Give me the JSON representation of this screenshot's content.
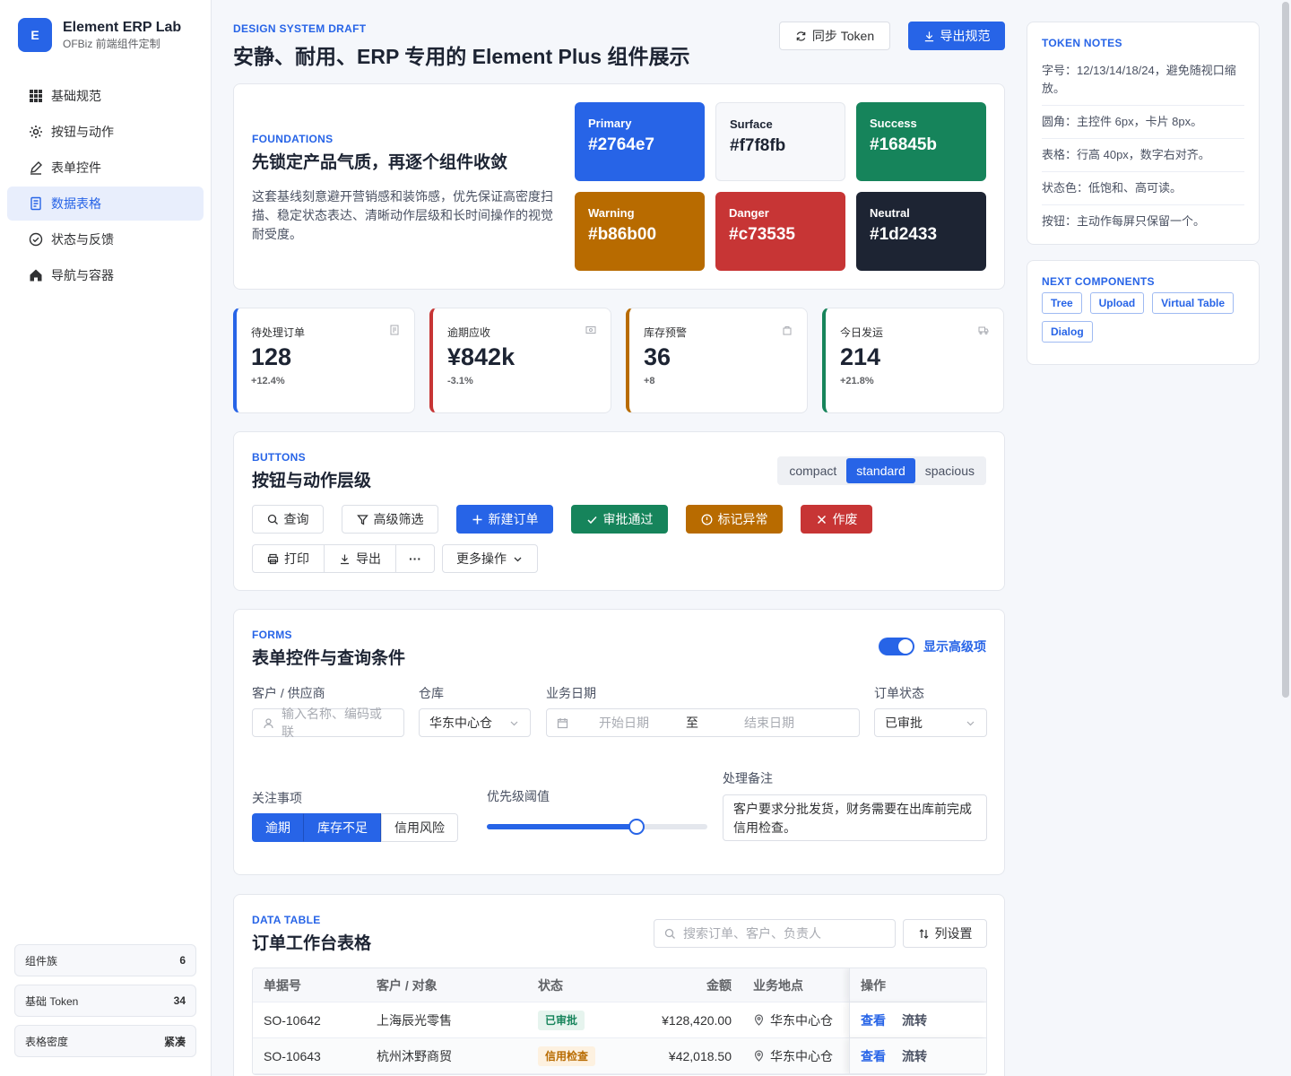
{
  "brand": {
    "logo": "E",
    "title": "Element ERP Lab",
    "subtitle": "OFBiz 前端组件定制"
  },
  "nav": [
    {
      "label": "基础规范",
      "icon": "grid-icon"
    },
    {
      "label": "按钮与动作",
      "icon": "gear-icon"
    },
    {
      "label": "表单控件",
      "icon": "edit-icon"
    },
    {
      "label": "数据表格",
      "icon": "document-icon",
      "active": true
    },
    {
      "label": "状态与反馈",
      "icon": "check-circle-icon"
    },
    {
      "label": "导航与容器",
      "icon": "home-icon"
    }
  ],
  "side_stats": [
    {
      "label": "组件族",
      "value": "6"
    },
    {
      "label": "基础 Token",
      "value": "34"
    },
    {
      "label": "表格密度",
      "value": "紧凑"
    }
  ],
  "header": {
    "eyebrow": "DESIGN SYSTEM DRAFT",
    "title": "安静、耐用、ERP 专用的 Element Plus 组件展示",
    "sync_label": "同步 Token",
    "export_label": "导出规范"
  },
  "foundations": {
    "eyebrow": "FOUNDATIONS",
    "title": "先锁定产品气质，再逐个组件收敛",
    "desc": "这套基线刻意避开营销感和装饰感，优先保证高密度扫描、稳定状态表达、清晰动作层级和长时间操作的视觉耐受度。",
    "swatches": [
      {
        "name": "Primary",
        "hex": "#2764e7",
        "bg": "#2764e7",
        "fg": "#ffffff"
      },
      {
        "name": "Surface",
        "hex": "#f7f8fb",
        "bg": "#f7f8fb",
        "fg": "#1d2433"
      },
      {
        "name": "Success",
        "hex": "#16845b",
        "bg": "#16845b",
        "fg": "#ffffff"
      },
      {
        "name": "Warning",
        "hex": "#b86b00",
        "bg": "#b86b00",
        "fg": "#ffffff"
      },
      {
        "name": "Danger",
        "hex": "#c73535",
        "bg": "#c73535",
        "fg": "#ffffff"
      },
      {
        "name": "Neutral",
        "hex": "#1d2433",
        "bg": "#1d2433",
        "fg": "#ffffff"
      }
    ]
  },
  "kpis": [
    {
      "label": "待处理订单",
      "value": "128",
      "delta": "+12.4%",
      "accent": "#2764e7",
      "icon": "document-icon"
    },
    {
      "label": "逾期应收",
      "value": "¥842k",
      "delta": "-3.1%",
      "accent": "#c73535",
      "icon": "money-icon"
    },
    {
      "label": "库存预警",
      "value": "36",
      "delta": "+8",
      "accent": "#b86b00",
      "icon": "box-icon"
    },
    {
      "label": "今日发运",
      "value": "214",
      "delta": "+21.8%",
      "accent": "#16845b",
      "icon": "truck-icon"
    }
  ],
  "buttons": {
    "eyebrow": "BUTTONS",
    "title": "按钮与动作层级",
    "density": [
      "compact",
      "standard",
      "spacious"
    ],
    "density_selected": "standard",
    "row1": [
      "查询",
      "高级筛选",
      "新建订单",
      "审批通过",
      "标记异常",
      "作废"
    ],
    "group": [
      "打印",
      "导出",
      "···"
    ],
    "more": "更多操作"
  },
  "forms": {
    "eyebrow": "FORMS",
    "title": "表单控件与查询条件",
    "toggle_label": "显示高级项",
    "customer_label": "客户 / 供应商",
    "customer_placeholder": "输入名称、编码或联",
    "warehouse_label": "仓库",
    "warehouse_value": "华东中心仓",
    "date_label": "业务日期",
    "date_start": "开始日期",
    "date_sep": "至",
    "date_end": "结束日期",
    "status_label": "订单状态",
    "status_value": "已审批",
    "focus_label": "关注事项",
    "focus_options": [
      "逾期",
      "库存不足",
      "信用风险"
    ],
    "priority_label": "优先级阈值",
    "priority_value": 0.68,
    "remark_label": "处理备注",
    "remark_value": "客户要求分批发货，财务需要在出库前完成信用检查。"
  },
  "table": {
    "eyebrow": "DATA TABLE",
    "title": "订单工作台表格",
    "search_placeholder": "搜索订单、客户、负责人",
    "columns_label": "列设置",
    "headers": [
      "单据号",
      "客户 / 对象",
      "状态",
      "金额",
      "业务地点",
      "操作"
    ],
    "rows": [
      {
        "id": "SO-10642",
        "customer": "上海辰光零售",
        "status": "已审批",
        "status_color": "#16845b",
        "status_bg": "#e6f4ee",
        "amount": "¥128,420.00",
        "location": "华东中心仓",
        "actions": [
          "查看",
          "流转"
        ]
      },
      {
        "id": "SO-10643",
        "customer": "杭州沐野商贸",
        "status": "信用检查",
        "status_color": "#b86b00",
        "status_bg": "#fdf1e0",
        "amount": "¥42,018.50",
        "location": "华东中心仓",
        "actions": [
          "查看",
          "流转"
        ]
      }
    ]
  },
  "token_notes": {
    "eyebrow": "TOKEN NOTES",
    "items": [
      "字号：12/13/14/18/24，避免随视口缩放。",
      "圆角：主控件 6px，卡片 8px。",
      "表格：行高 40px，数字右对齐。",
      "状态色：低饱和、高可读。",
      "按钮：主动作每屏只保留一个。"
    ]
  },
  "next_components": {
    "eyebrow": "NEXT COMPONENTS",
    "items": [
      "Tree",
      "Upload",
      "Virtual Table",
      "Dialog"
    ]
  }
}
